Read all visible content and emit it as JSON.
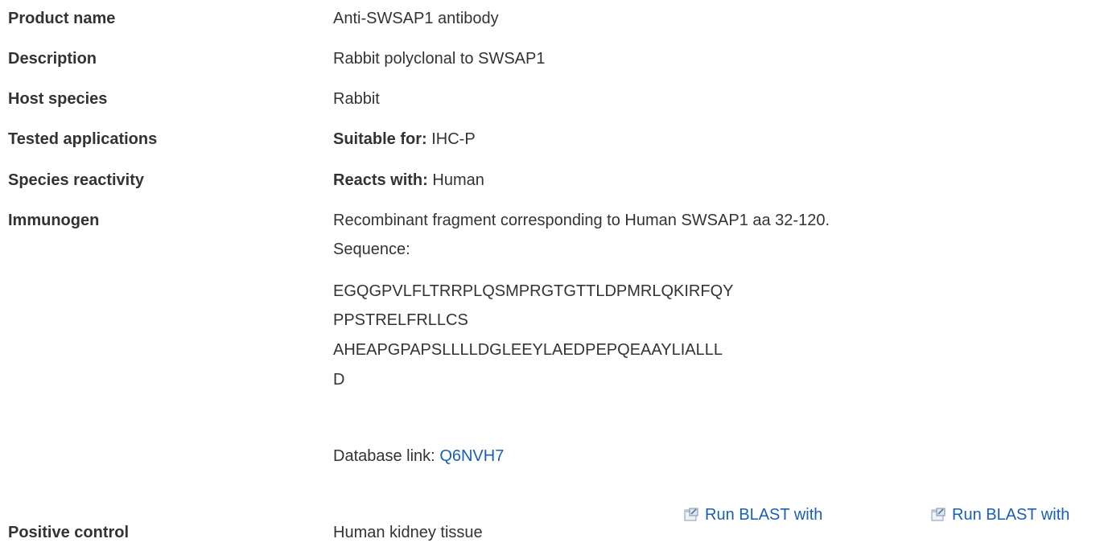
{
  "rows": {
    "product_name": {
      "label": "Product name",
      "value": "Anti-SWSAP1 antibody"
    },
    "description": {
      "label": "Description",
      "value": "Rabbit polyclonal to SWSAP1"
    },
    "host_species": {
      "label": "Host species",
      "value": "Rabbit"
    },
    "tested_applications": {
      "label": "Tested applications",
      "prefix": "Suitable for:",
      "value": "IHC-P"
    },
    "species_reactivity": {
      "label": "Species reactivity",
      "prefix": "Reacts with:",
      "value": "Human"
    },
    "immunogen": {
      "label": "Immunogen",
      "value": "Recombinant fragment corresponding to Human SWSAP1 aa 32-120.",
      "sequence_label": "Sequence:",
      "sequence_lines": [
        "EGQGPVLFLTRRPLQSMPRGTGTTLDPMRLQKIRFQY",
        "PPSTRELFRLLCS",
        "AHEAPGPAPSLLLLDGLEEYLAEDPEPQEAAYLIALLL",
        "D"
      ],
      "database_label": "Database link:",
      "database_link": "Q6NVH7",
      "blast_links": [
        "Run BLAST with",
        "Run BLAST with"
      ]
    },
    "positive_control": {
      "label": "Positive control",
      "value": "Human kidney tissue"
    }
  },
  "colors": {
    "text": "#333333",
    "link": "#1a5fb4"
  },
  "icons": {
    "blast": "external-window-icon"
  }
}
